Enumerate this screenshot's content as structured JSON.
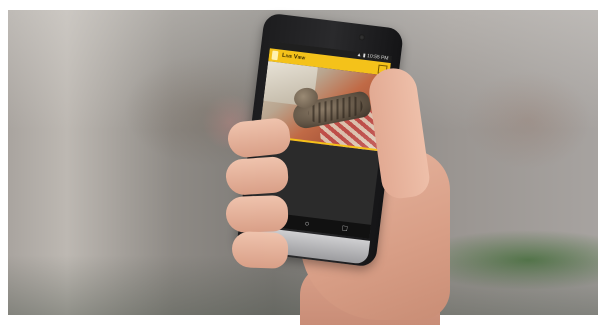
{
  "status_bar": {
    "time": "10:55 PM"
  },
  "app": {
    "title": "Live View"
  },
  "icons": {
    "app": "app-icon",
    "menu": "menu-icon",
    "nav_back": "back-icon",
    "nav_home": "home-icon",
    "nav_recents": "recents-icon"
  },
  "colors": {
    "appbar": "#f4c21a",
    "screen_bg": "#2b2b2b"
  }
}
